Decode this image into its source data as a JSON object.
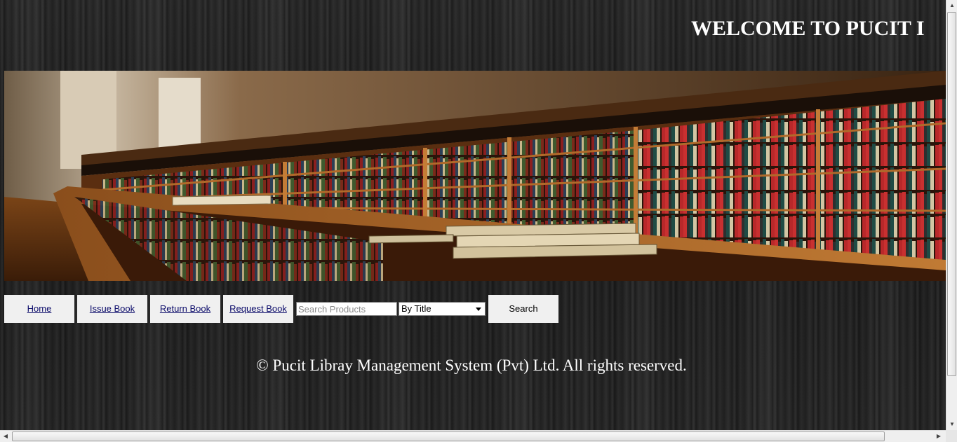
{
  "header": {
    "welcome_text": "WELCOME TO PUCIT I"
  },
  "banner": {
    "subject": "library bookshelves with stacked books",
    "colors": {
      "wood": "#8a4a1e",
      "wall": "#b9a58a"
    }
  },
  "nav": {
    "items": [
      {
        "label": "Home"
      },
      {
        "label": "Issue Book"
      },
      {
        "label": "Return Book"
      },
      {
        "label": "Request Book"
      }
    ]
  },
  "search": {
    "placeholder": "Search Products",
    "value": "",
    "filter_selected": "By Title",
    "button_label": "Search"
  },
  "footer": {
    "text": "© Pucit Libray Management System (Pvt) Ltd. All rights reserved."
  },
  "scrollbars": {
    "vertical_icons": [
      "up-arrow",
      "grip",
      "down-arrow"
    ],
    "horizontal_icons": [
      "left-arrow",
      "grip",
      "right-arrow"
    ]
  }
}
